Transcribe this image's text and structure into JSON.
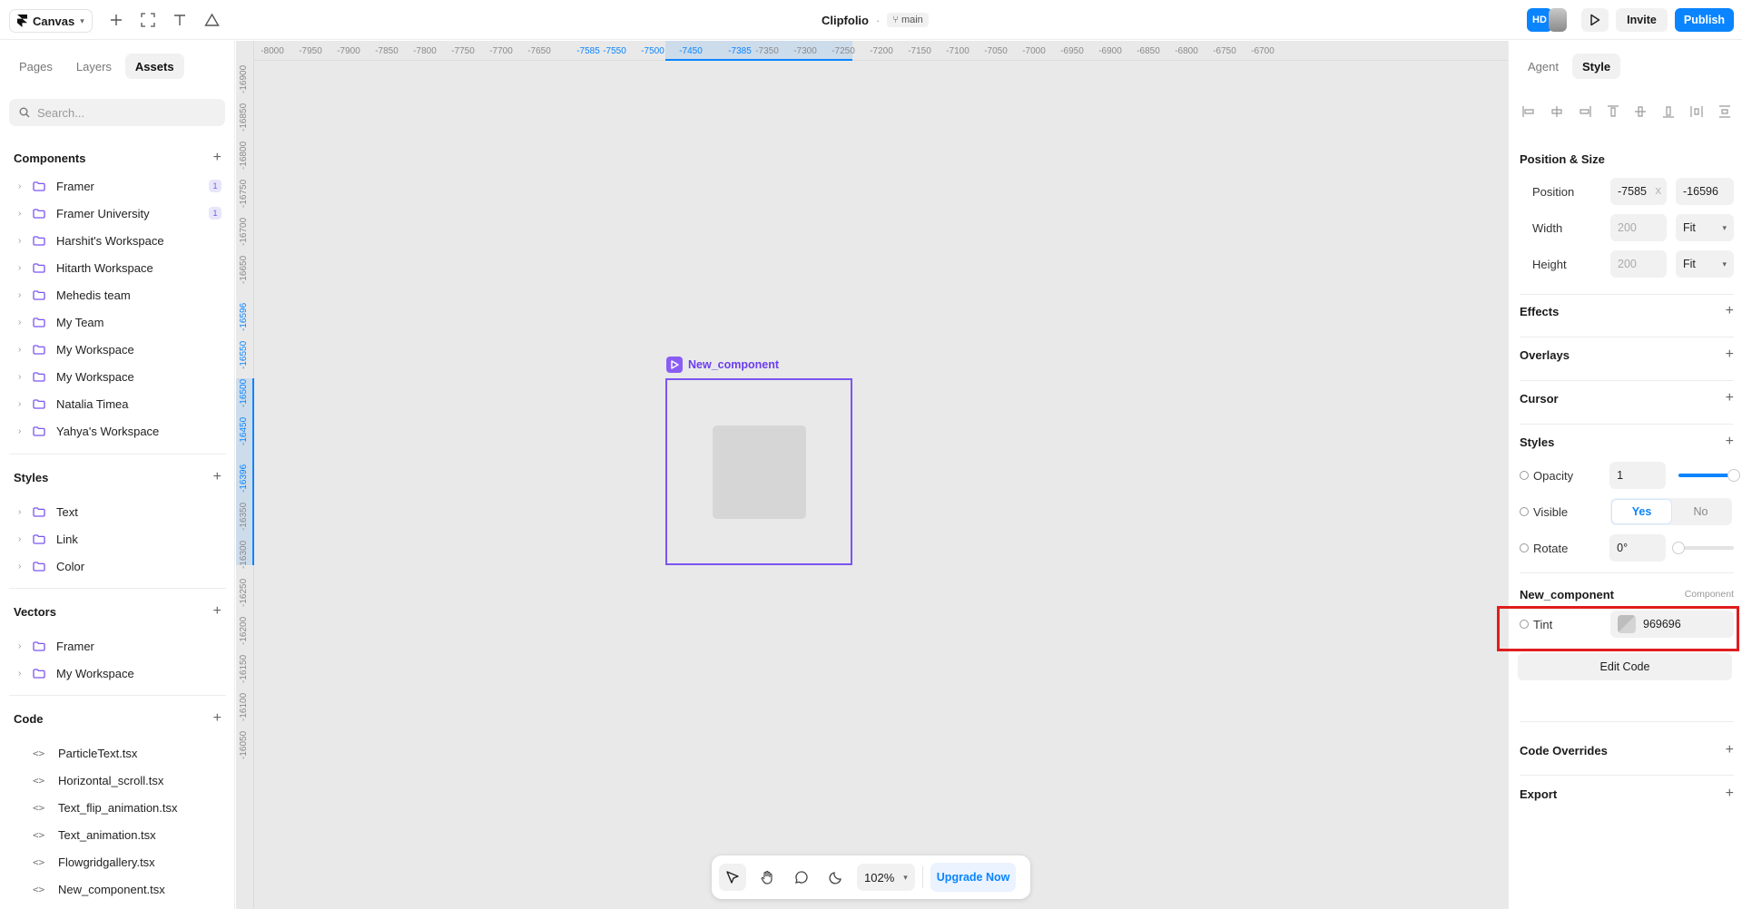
{
  "topbar": {
    "canvas_label": "Canvas",
    "project_title": "Clipfolio",
    "title_separator": "·",
    "branch": "main",
    "avatar_initials": "HD",
    "invite_label": "Invite",
    "publish_label": "Publish"
  },
  "left_panel": {
    "tabs": [
      "Pages",
      "Layers",
      "Assets"
    ],
    "active_tab": "Assets",
    "search_placeholder": "Search...",
    "components": {
      "title": "Components",
      "items": [
        {
          "label": "Framer",
          "badge": "1"
        },
        {
          "label": "Framer University",
          "badge": "1"
        },
        {
          "label": "Harshit's Workspace"
        },
        {
          "label": "Hitarth Workspace"
        },
        {
          "label": "Mehedis team"
        },
        {
          "label": "My Team"
        },
        {
          "label": "My Workspace"
        },
        {
          "label": "My Workspace"
        },
        {
          "label": "Natalia Timea"
        },
        {
          "label": "Yahya's Workspace"
        }
      ]
    },
    "styles": {
      "title": "Styles",
      "items": [
        {
          "label": "Text"
        },
        {
          "label": "Link"
        },
        {
          "label": "Color"
        }
      ]
    },
    "vectors": {
      "title": "Vectors",
      "items": [
        {
          "label": "Framer"
        },
        {
          "label": "My Workspace"
        }
      ]
    },
    "code": {
      "title": "Code",
      "items": [
        {
          "label": "ParticleText.tsx"
        },
        {
          "label": "Horizontal_scroll.tsx"
        },
        {
          "label": "Text_flip_animation.tsx"
        },
        {
          "label": "Text_animation.tsx"
        },
        {
          "label": "Flowgridgallery.tsx"
        },
        {
          "label": "New_component.tsx"
        }
      ]
    }
  },
  "canvas": {
    "ruler_h": [
      "-8000",
      "-7950",
      "-7900",
      "-7850",
      "-7800",
      "-7750",
      "-7700",
      "-7650",
      "-7585",
      "-7550",
      "-7500",
      "-7450",
      "-7385",
      "-7350",
      "-7300",
      "-7250",
      "-7200",
      "-7150",
      "-7100",
      "-7050",
      "-7000",
      "-6950",
      "-6900",
      "-6850",
      "-6800",
      "-6750",
      "-6700"
    ],
    "ruler_v": [
      "-16900",
      "-16850",
      "-16800",
      "-16750",
      "-16700",
      "-16650",
      "-16596",
      "-16550",
      "-16500",
      "-16450",
      "-16396",
      "-16350",
      "-16300",
      "-16250",
      "-16200",
      "-16150",
      "-16100",
      "-16050"
    ],
    "component_label": "New_component"
  },
  "bottombar": {
    "zoom": "102%",
    "upgrade_label": "Upgrade Now"
  },
  "right_panel": {
    "tabs": [
      "Agent",
      "Style"
    ],
    "active_tab": "Style",
    "position_size": {
      "title": "Position & Size",
      "position_label": "Position",
      "pos_x": "-7585",
      "pos_x_suffix": "X",
      "pos_y": "-16596",
      "width_label": "Width",
      "width_value": "200",
      "width_mode": "Fit",
      "height_label": "Height",
      "height_value": "200",
      "height_mode": "Fit"
    },
    "sections": {
      "effects": "Effects",
      "overlays": "Overlays",
      "cursor": "Cursor",
      "styles": "Styles",
      "code_overrides": "Code Overrides",
      "export": "Export"
    },
    "styles_props": {
      "opacity_label": "Opacity",
      "opacity_value": "1",
      "opacity_level": 1.0,
      "visible_label": "Visible",
      "visible_yes": "Yes",
      "visible_no": "No",
      "rotate_label": "Rotate",
      "rotate_value": "0°",
      "rotate_level": 0.0
    },
    "component_section": {
      "title": "New_component",
      "kind": "Component",
      "tint_label": "Tint",
      "tint_value": "969696",
      "edit_code_label": "Edit Code"
    }
  }
}
